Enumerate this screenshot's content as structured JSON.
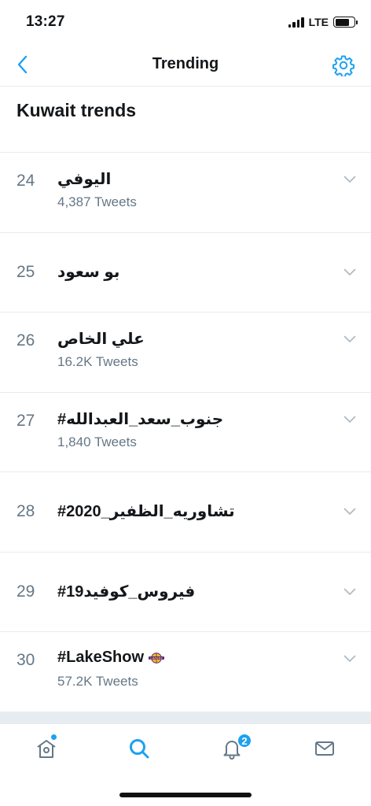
{
  "status_bar": {
    "time": "13:27",
    "network": "LTE"
  },
  "header": {
    "title": "Trending",
    "back_icon": "chevron-left-icon",
    "settings_icon": "gear-icon"
  },
  "section": {
    "title": "Kuwait trends"
  },
  "trends": [
    {
      "rank": "24",
      "name": "اليوفي",
      "count": "4,387 Tweets"
    },
    {
      "rank": "25",
      "name": "بو سعود"
    },
    {
      "rank": "26",
      "name": "علي الخاص",
      "count": "16.2K Tweets"
    },
    {
      "rank": "27",
      "name": "#جنوب_سعد_العبدالله",
      "count": "1,840 Tweets"
    },
    {
      "rank": "28",
      "name": "#تشاوريه_الظفير_2020"
    },
    {
      "rank": "29",
      "name": "#فيروس_كوفيد19"
    },
    {
      "rank": "30",
      "name": "#LakeShow",
      "count": "57.2K Tweets",
      "emoji": "lakers-logo"
    }
  ],
  "tabs": {
    "home": {
      "icon": "home-icon",
      "has_dot": true
    },
    "search": {
      "icon": "search-icon",
      "active": true
    },
    "notifications": {
      "icon": "bell-icon",
      "badge": "2"
    },
    "messages": {
      "icon": "mail-icon"
    }
  },
  "colors": {
    "accent": "#1da1f2",
    "text": "#14171a",
    "secondary": "#657786",
    "divider": "#e6ecf0"
  }
}
